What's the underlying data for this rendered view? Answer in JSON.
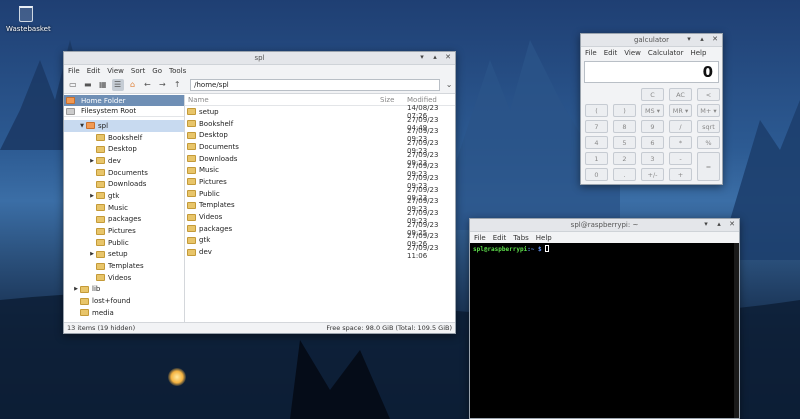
{
  "desktop": {
    "trash_label": "Wastebasket"
  },
  "file_manager": {
    "title": "spl",
    "menu": [
      "File",
      "Edit",
      "View",
      "Sort",
      "Go",
      "Tools"
    ],
    "path": "/home/spl",
    "places": {
      "home": "Home Folder",
      "root": "Filesystem Root"
    },
    "tree": [
      {
        "label": "spl",
        "level": 0,
        "arrow": "▼",
        "home": true
      },
      {
        "label": "Bookshelf",
        "level": 1,
        "arrow": ""
      },
      {
        "label": "Desktop",
        "level": 1,
        "arrow": ""
      },
      {
        "label": "dev",
        "level": 1,
        "arrow": "▶"
      },
      {
        "label": "Documents",
        "level": 1,
        "arrow": ""
      },
      {
        "label": "Downloads",
        "level": 1,
        "arrow": ""
      },
      {
        "label": "gtk",
        "level": 1,
        "arrow": "▶"
      },
      {
        "label": "Music",
        "level": 1,
        "arrow": ""
      },
      {
        "label": "packages",
        "level": 1,
        "arrow": ""
      },
      {
        "label": "Pictures",
        "level": 1,
        "arrow": ""
      },
      {
        "label": "Public",
        "level": 1,
        "arrow": ""
      },
      {
        "label": "setup",
        "level": 1,
        "arrow": "▶"
      },
      {
        "label": "Templates",
        "level": 1,
        "arrow": ""
      },
      {
        "label": "Videos",
        "level": 1,
        "arrow": ""
      },
      {
        "label": "lib",
        "level": -1,
        "arrow": "▶"
      },
      {
        "label": "lost+found",
        "level": -1,
        "arrow": ""
      },
      {
        "label": "media",
        "level": -1,
        "arrow": ""
      }
    ],
    "columns": {
      "name": "Name",
      "size": "Size",
      "modified": "Modified"
    },
    "files": [
      {
        "name": "setup",
        "modified": "14/08/23 07:26"
      },
      {
        "name": "Bookshelf",
        "modified": "27/09/23 04:49"
      },
      {
        "name": "Desktop",
        "modified": "27/09/23 09:23"
      },
      {
        "name": "Documents",
        "modified": "27/09/23 09:23"
      },
      {
        "name": "Downloads",
        "modified": "27/09/23 09:23"
      },
      {
        "name": "Music",
        "modified": "27/09/23 09:23"
      },
      {
        "name": "Pictures",
        "modified": "27/09/23 09:23"
      },
      {
        "name": "Public",
        "modified": "27/09/23 09:23"
      },
      {
        "name": "Templates",
        "modified": "27/09/23 09:23"
      },
      {
        "name": "Videos",
        "modified": "27/09/23 09:23"
      },
      {
        "name": "packages",
        "modified": "27/09/23 09:25"
      },
      {
        "name": "gtk",
        "modified": "27/09/23 09:26"
      },
      {
        "name": "dev",
        "modified": "27/09/23 11:06"
      }
    ],
    "status_left": "13 items (19 hidden)",
    "status_right": "Free space: 98.0 GiB (Total: 109.5 GiB)"
  },
  "calculator": {
    "title": "galculator",
    "menu": [
      "File",
      "Edit",
      "View",
      "Calculator",
      "Help"
    ],
    "display": "0",
    "keys": [
      {
        "label": "C"
      },
      {
        "label": "AC"
      },
      {
        "label": "<"
      },
      {
        "label": "("
      },
      {
        "label": ")"
      },
      {
        "label": "MS ▾"
      },
      {
        "label": "MR ▾"
      },
      {
        "label": "M+ ▾"
      },
      {
        "label": "7"
      },
      {
        "label": "8"
      },
      {
        "label": "9"
      },
      {
        "label": "/"
      },
      {
        "label": "sqrt"
      },
      {
        "label": "4"
      },
      {
        "label": "5"
      },
      {
        "label": "6"
      },
      {
        "label": "*"
      },
      {
        "label": "%"
      },
      {
        "label": "1"
      },
      {
        "label": "2"
      },
      {
        "label": "3"
      },
      {
        "label": "-"
      },
      {
        "label": "="
      },
      {
        "label": "0"
      },
      {
        "label": "."
      },
      {
        "label": "+/-"
      },
      {
        "label": "+"
      }
    ]
  },
  "terminal": {
    "title": "spl@raspberrypi: ~",
    "menu": [
      "File",
      "Edit",
      "Tabs",
      "Help"
    ],
    "prompt_user": "spl@raspberrypi",
    "prompt_path": ":~ $"
  }
}
